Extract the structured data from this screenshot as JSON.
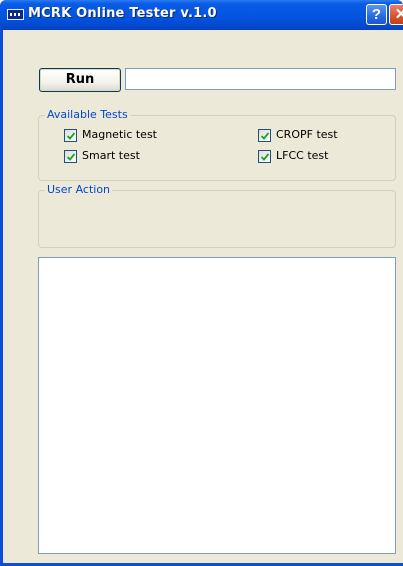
{
  "window": {
    "title": "MCRK Online Tester v.1.0",
    "help_glyph": "?",
    "close_glyph": "✕",
    "colors": {
      "titlebar": "#0454e0",
      "client_bg": "#ece9d8",
      "group_title": "#0046d5",
      "checkmark": "#21a121",
      "close_button": "#d6552f"
    }
  },
  "toolbar": {
    "run_label": "Run",
    "command_value": ""
  },
  "available_tests": {
    "title": "Available Tests",
    "tests": [
      {
        "label": "Magnetic test",
        "checked": true
      },
      {
        "label": "Smart test",
        "checked": true
      },
      {
        "label": "CROPF test",
        "checked": true
      },
      {
        "label": "LFCC test",
        "checked": true
      }
    ]
  },
  "user_action": {
    "title": "User Action"
  },
  "output": {
    "text": ""
  }
}
